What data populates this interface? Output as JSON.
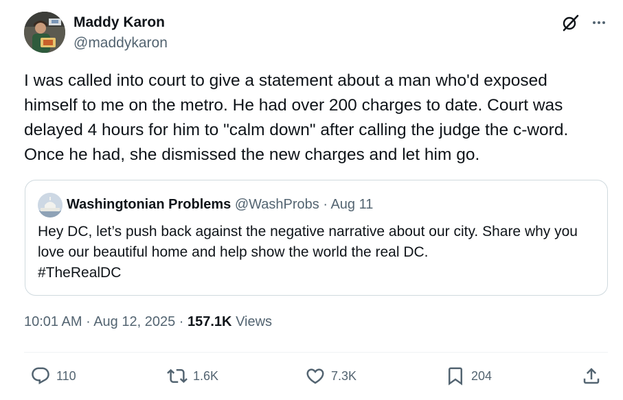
{
  "author": {
    "name": "Maddy Karon",
    "handle": "@maddykaron"
  },
  "tweet": {
    "text": "I was called into court to give a statement about a man who'd exposed himself to me on the metro. He had over 200 charges to date. Court was delayed 4 hours for him to \"calm down\" after calling the judge the c-word. Once he had, she dismissed the new charges and let him go."
  },
  "quoted_tweet": {
    "name": "Washingtonian Problems",
    "handle": "@WashProbs",
    "separator": "·",
    "date": "Aug 11",
    "text": "Hey DC, let’s push back against the negative narrative about our city. Share why you love our beautiful home and help show the world the real DC.\n#TheRealDC"
  },
  "meta": {
    "time": "10:01 AM",
    "separator": "·",
    "date": "Aug 12, 2025",
    "views_count": "157.1K",
    "views_label": "Views"
  },
  "actions": {
    "replies": "110",
    "reposts": "1.6K",
    "likes": "7.3K",
    "bookmarks": "204"
  },
  "icons": {
    "grok": "grok-icon",
    "more": "more-icon",
    "reply": "reply-icon",
    "repost": "repost-icon",
    "like": "heart-icon",
    "bookmark": "bookmark-icon",
    "share": "share-icon"
  }
}
